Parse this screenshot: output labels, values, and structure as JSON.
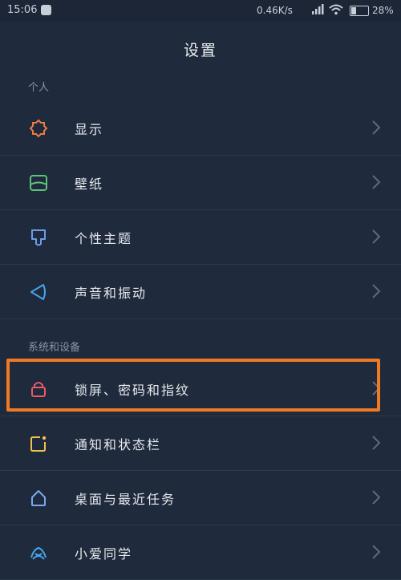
{
  "status_bar": {
    "time": "15:06",
    "network_speed": "0.46K/s",
    "battery_percent": "28%",
    "battery_level": 0.28
  },
  "header": {
    "title": "设置"
  },
  "sections": [
    {
      "label": "个人",
      "items": [
        {
          "label": "显示",
          "icon": "display-sun-icon",
          "color": "#f07a44"
        },
        {
          "label": "壁纸",
          "icon": "wallpaper-icon",
          "color": "#5fc27a"
        },
        {
          "label": "个性主题",
          "icon": "theme-icon",
          "color": "#6f9be8"
        },
        {
          "label": "声音和振动",
          "icon": "sound-icon",
          "color": "#4aa3e8"
        }
      ]
    },
    {
      "label": "系统和设备",
      "items": [
        {
          "label": "锁屏、密码和指纹",
          "icon": "lock-icon",
          "color": "#e95a6a"
        },
        {
          "label": "通知和状态栏",
          "icon": "notification-icon",
          "color": "#f2c14a"
        },
        {
          "label": "桌面与最近任务",
          "icon": "home-icon",
          "color": "#7aa8f0"
        },
        {
          "label": "小爱同学",
          "icon": "assistant-icon",
          "color": "#4aa3e8"
        }
      ]
    }
  ],
  "colors": {
    "background": "#1f2a3c",
    "highlight": "#f07a24"
  }
}
